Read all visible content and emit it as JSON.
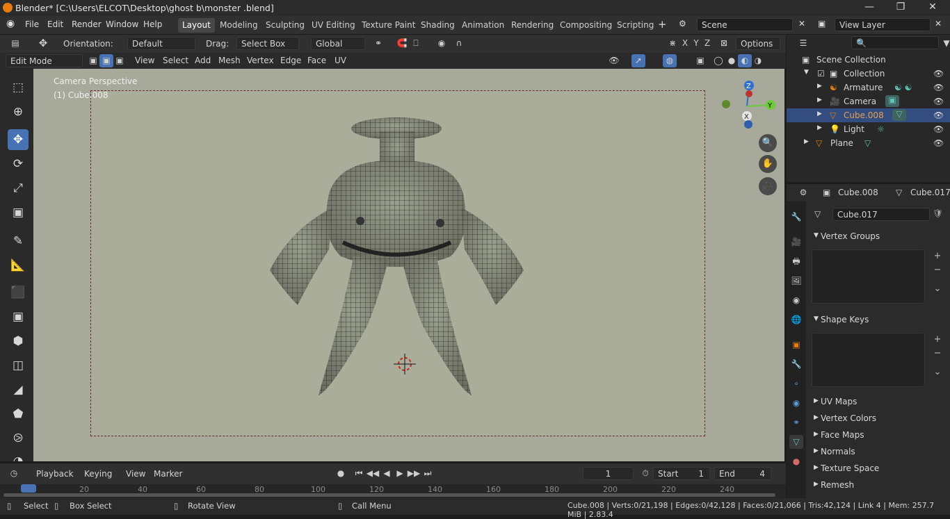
{
  "window": {
    "title": "Blender* [C:\\Users\\ELCOT\\Desktop\\ghost b\\monster .blend]"
  },
  "menu": [
    "File",
    "Edit",
    "Render",
    "Window",
    "Help"
  ],
  "workspaces": [
    "Layout",
    "Modeling",
    "Sculpting",
    "UV Editing",
    "Texture Paint",
    "Shading",
    "Animation",
    "Rendering",
    "Compositing",
    "Scripting"
  ],
  "active_workspace": "Layout",
  "scene": "Scene",
  "view_layer": "View Layer",
  "header": {
    "orientation_label": "Orientation:",
    "orientation_value": "Default",
    "drag_label": "Drag:",
    "drag_value": "Select Box",
    "transform_value": "Global",
    "axes": [
      "X",
      "Y",
      "Z"
    ],
    "options": "Options"
  },
  "mode": "Edit Mode",
  "edit_menu": [
    "View",
    "Select",
    "Add",
    "Mesh",
    "Vertex",
    "Edge",
    "Face",
    "UV"
  ],
  "viewport": {
    "label1": "Camera Perspective",
    "label2": "(1) Cube.008",
    "gizmo_axes": {
      "z": "Z",
      "y": "Y",
      "x": "X"
    }
  },
  "timeline": {
    "menus": [
      "Playback",
      "Keying",
      "View",
      "Marker"
    ],
    "current_frame": "1",
    "start_label": "Start",
    "start": "1",
    "end_label": "End",
    "end": "4",
    "ticks": [
      "20",
      "40",
      "60",
      "80",
      "100",
      "120",
      "140",
      "160",
      "180",
      "200",
      "220",
      "240"
    ]
  },
  "statusbar": {
    "select": "Select",
    "box_select": "Box Select",
    "rotate": "Rotate View",
    "call_menu": "Call Menu",
    "stats": "Cube.008 | Verts:0/21,198 | Edges:0/42,128 | Faces:0/21,066 | Tris:42,124 | Link 4 | Mem: 257.7 MiB | 2.83.4"
  },
  "outliner": {
    "rows": [
      {
        "label": "Scene Collection"
      },
      {
        "label": "Collection"
      },
      {
        "label": "Armature"
      },
      {
        "label": "Camera"
      },
      {
        "label": "Cube.008"
      },
      {
        "label": "Light"
      },
      {
        "label": "Plane"
      }
    ]
  },
  "properties": {
    "object_name": "Cube.008",
    "mesh_name": "Cube.017",
    "datablock": "Cube.017",
    "panels": {
      "vertex_groups": "Vertex Groups",
      "shape_keys": "Shape Keys"
    },
    "collapsed": [
      "UV Maps",
      "Vertex Colors",
      "Face Maps",
      "Normals",
      "Texture Space",
      "Remesh"
    ]
  },
  "colors": {
    "accent": "#4772b3",
    "selected_row": "#334d80",
    "orange": "#e87d0d",
    "green": "#5ec5b4"
  }
}
